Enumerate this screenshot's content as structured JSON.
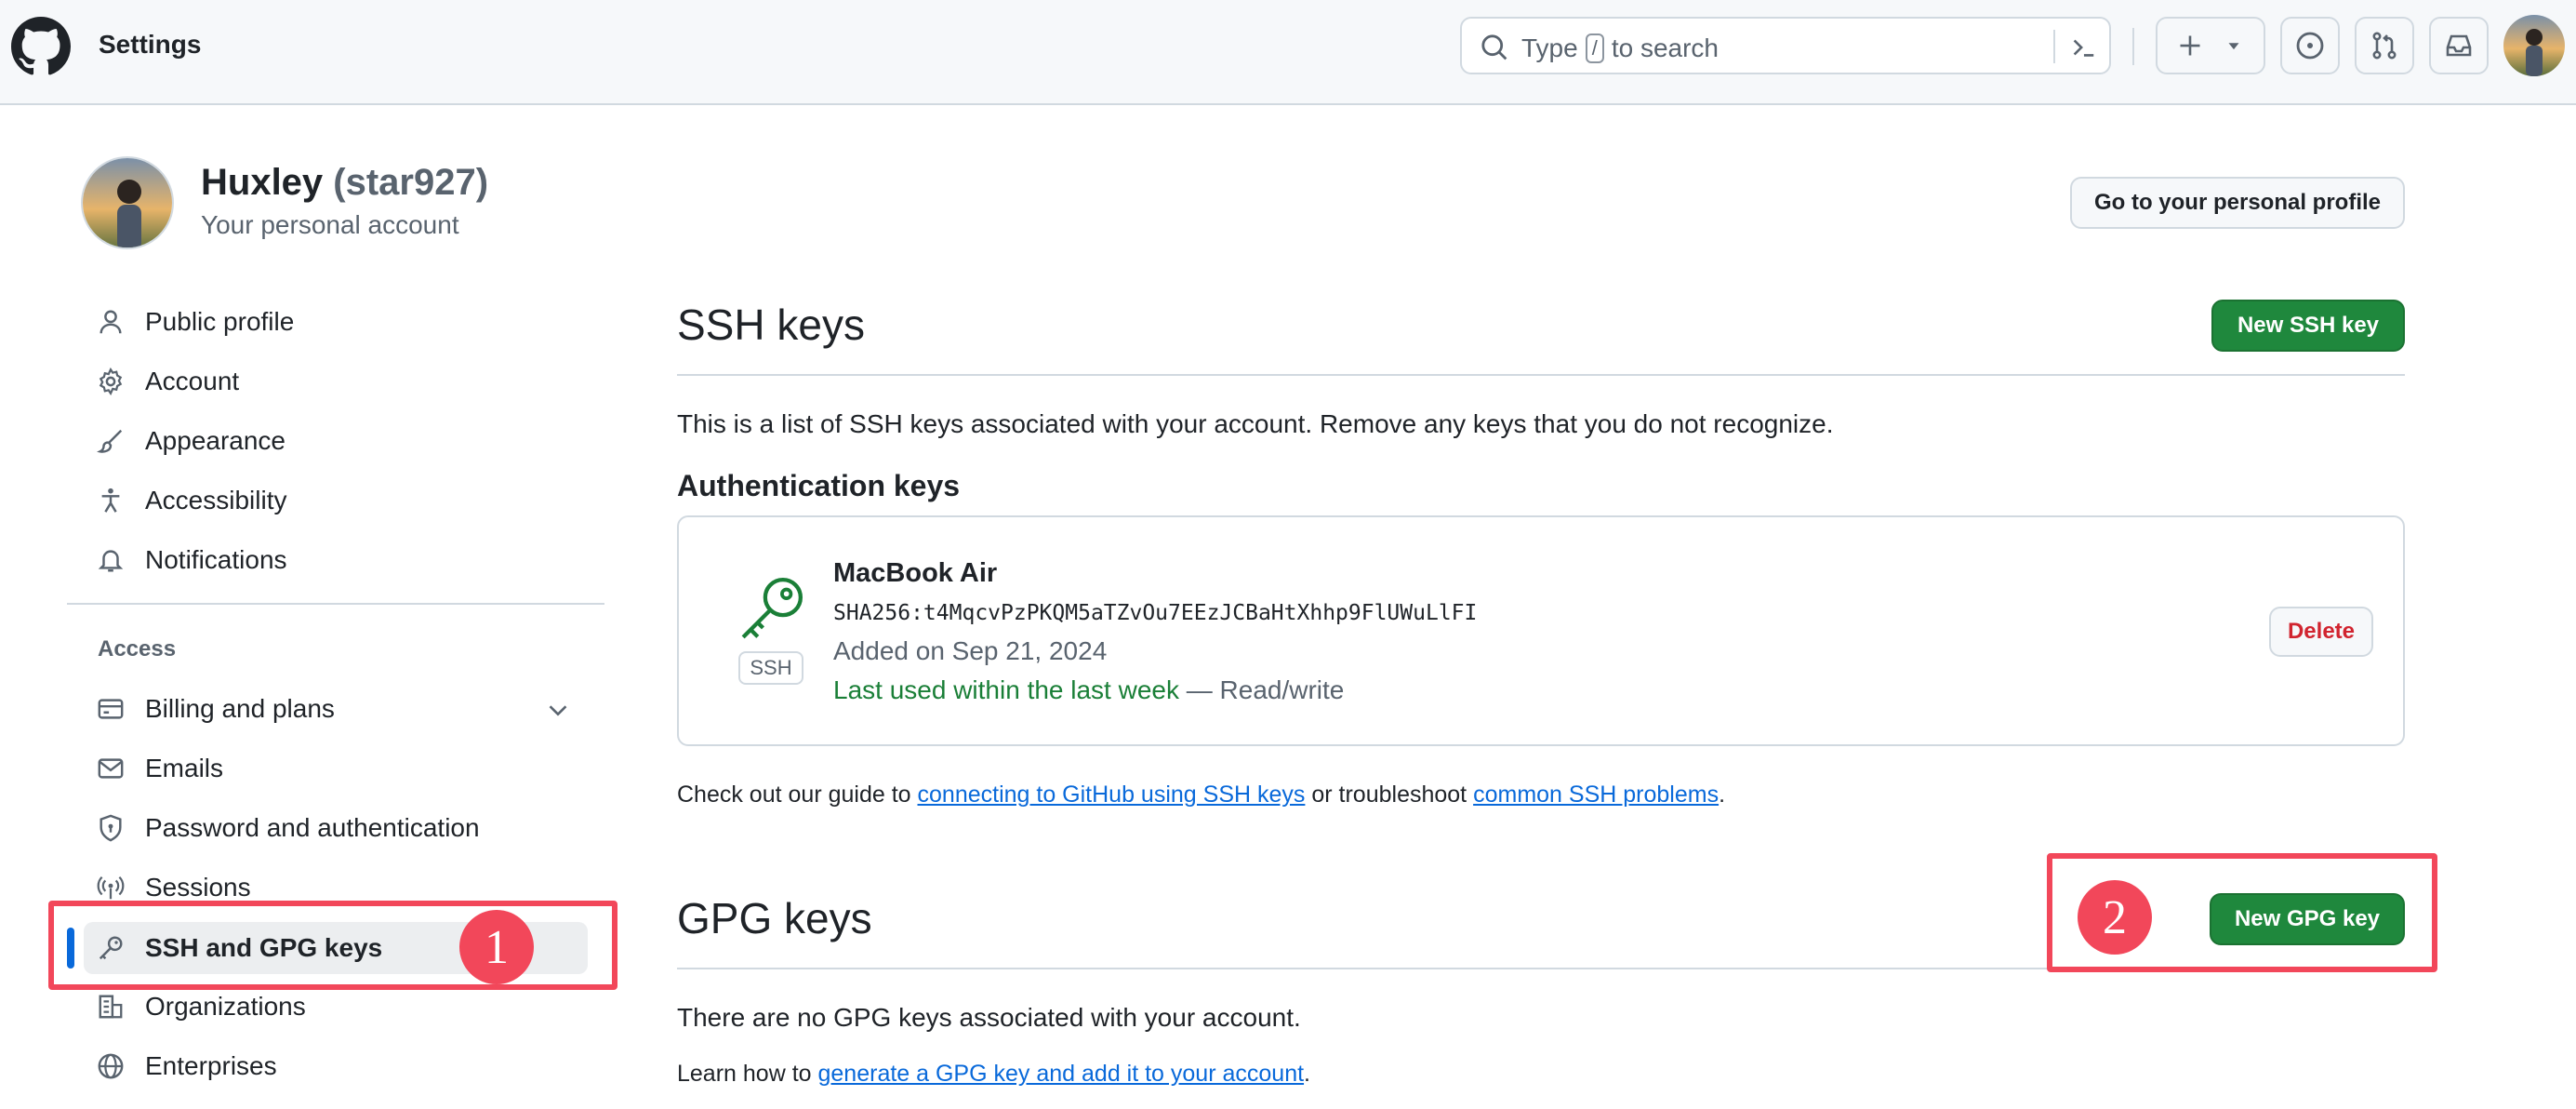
{
  "header": {
    "title": "Settings",
    "search": {
      "prefix": "Type",
      "key": "/",
      "suffix": "to search"
    }
  },
  "account": {
    "name": "Huxley",
    "handle": "(star927)",
    "subtitle": "Your personal account",
    "profile_button": "Go to your personal profile"
  },
  "sidebar": {
    "items": [
      {
        "label": "Public profile",
        "icon": "person-icon"
      },
      {
        "label": "Account",
        "icon": "gear-icon"
      },
      {
        "label": "Appearance",
        "icon": "paintbrush-icon"
      },
      {
        "label": "Accessibility",
        "icon": "accessibility-icon"
      },
      {
        "label": "Notifications",
        "icon": "bell-icon"
      }
    ],
    "access_heading": "Access",
    "access_items": [
      {
        "label": "Billing and plans",
        "icon": "credit-card-icon"
      },
      {
        "label": "Emails",
        "icon": "mail-icon"
      },
      {
        "label": "Password and authentication",
        "icon": "shield-lock-icon"
      },
      {
        "label": "Sessions",
        "icon": "broadcast-icon"
      },
      {
        "label": "SSH and GPG keys",
        "icon": "key-icon",
        "active": true
      },
      {
        "label": "Organizations",
        "icon": "organization-icon"
      },
      {
        "label": "Enterprises",
        "icon": "globe-icon"
      }
    ]
  },
  "ssh": {
    "title": "SSH keys",
    "new_button": "New SSH key",
    "description": "This is a list of SSH keys associated with your account. Remove any keys that you do not recognize.",
    "auth_heading": "Authentication keys",
    "key": {
      "badge": "SSH",
      "name": "MacBook Air",
      "fingerprint": "SHA256:t4MqcvPzPKQM5aTZvOu7EEzJCBaHtXhhp9FlUWuLlFI",
      "added": "Added on Sep 21, 2024",
      "last_used": "Last used within the last week",
      "access": "— Read/write",
      "delete_button": "Delete"
    },
    "guide": {
      "prefix": "Check out our guide to",
      "link1": "connecting to GitHub using SSH keys",
      "middle": "or troubleshoot",
      "link2": "common SSH problems",
      "suffix": "."
    }
  },
  "gpg": {
    "title": "GPG keys",
    "new_button": "New GPG key",
    "empty": "There are no GPG keys associated with your account.",
    "learn": {
      "prefix": "Learn how to",
      "link": "generate a GPG key and add it to your account",
      "suffix": "."
    }
  },
  "annotations": {
    "one": "1",
    "two": "2"
  },
  "colors": {
    "primary_button": "#1f883d",
    "link": "#0969da",
    "success": "#1a7f37",
    "danger": "#d1242f",
    "annotation": "#f2475a",
    "active_indicator": "#0969da"
  }
}
